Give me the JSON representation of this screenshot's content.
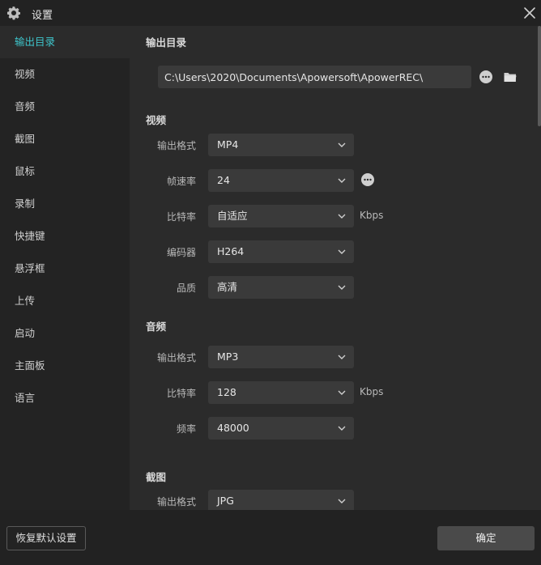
{
  "window": {
    "title": "设置"
  },
  "sidebar": {
    "items": [
      {
        "label": "输出目录",
        "active": true
      },
      {
        "label": "视频"
      },
      {
        "label": "音频"
      },
      {
        "label": "截图"
      },
      {
        "label": "鼠标"
      },
      {
        "label": "录制"
      },
      {
        "label": "快捷键"
      },
      {
        "label": "悬浮框"
      },
      {
        "label": "上传"
      },
      {
        "label": "启动"
      },
      {
        "label": "主面板"
      },
      {
        "label": "语言"
      }
    ]
  },
  "output": {
    "title": "输出目录",
    "path": "C:\\Users\\2020\\Documents\\Apowersoft\\ApowerREC\\"
  },
  "video": {
    "title": "视频",
    "format_label": "输出格式",
    "format": "MP4",
    "fps_label": "帧速率",
    "fps": "24",
    "bitrate_label": "比特率",
    "bitrate": "自适应",
    "bitrate_unit": "Kbps",
    "encoder_label": "编码器",
    "encoder": "H264",
    "quality_label": "品质",
    "quality": "高清"
  },
  "audio": {
    "title": "音频",
    "format_label": "输出格式",
    "format": "MP3",
    "bitrate_label": "比特率",
    "bitrate": "128",
    "bitrate_unit": "Kbps",
    "freq_label": "频率",
    "freq": "48000"
  },
  "screenshot": {
    "title": "截图",
    "format_label": "输出格式",
    "format": "JPG"
  },
  "footer": {
    "reset_label": "恢复默认设置",
    "ok_label": "确定"
  },
  "colors": {
    "accent": "#3ec6cc",
    "background": "#2b2b2b",
    "sidebar": "#232323"
  }
}
